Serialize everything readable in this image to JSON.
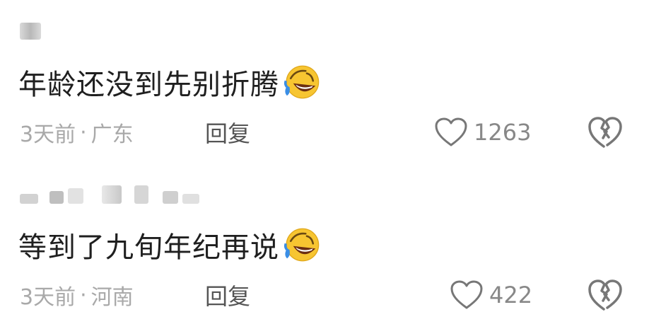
{
  "comments": [
    {
      "text": "年龄还没到先别折腾",
      "emoji": "rolling-on-floor-laughing-icon",
      "time": "3天前",
      "separator": "·",
      "location": "广东",
      "reply_label": "回复",
      "like_count": "1263"
    },
    {
      "text": "等到了九旬年纪再说",
      "emoji": "rolling-on-floor-laughing-icon",
      "time": "3天前",
      "separator": "·",
      "location": "河南",
      "reply_label": "回复",
      "like_count": "422"
    }
  ],
  "colors": {
    "text": "#1f1f1f",
    "meta": "#a9a9a9",
    "reply": "#555555",
    "icon": "#777777",
    "emoji_face": "#f7c531",
    "tear": "#3a8ee6"
  }
}
